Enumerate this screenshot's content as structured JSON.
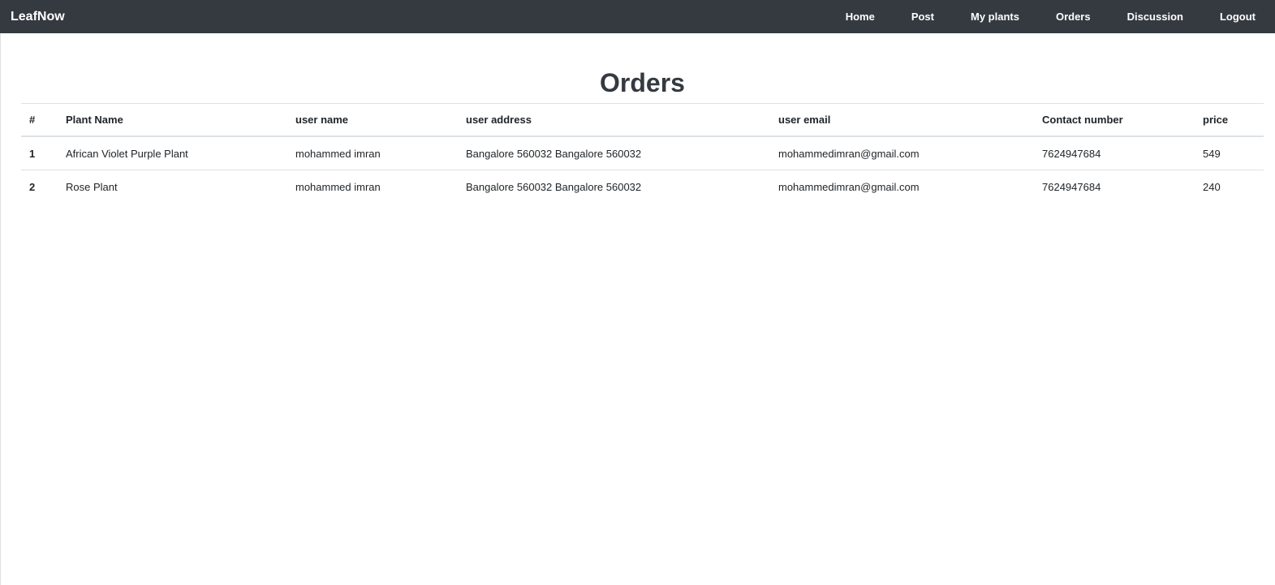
{
  "navbar": {
    "brand": "LeafNow",
    "links": [
      {
        "label": "Home"
      },
      {
        "label": "Post"
      },
      {
        "label": "My plants"
      },
      {
        "label": "Orders"
      },
      {
        "label": "Discussion"
      },
      {
        "label": "Logout"
      }
    ]
  },
  "page": {
    "title": "Orders"
  },
  "table": {
    "columns": [
      "#",
      "Plant Name",
      "user name",
      "user address",
      "user email",
      "Contact number",
      "price"
    ],
    "rows": [
      [
        "1",
        "African Violet Purple Plant",
        "mohammed imran",
        "Bangalore 560032 Bangalore 560032",
        "mohammedimran@gmail.com",
        "7624947684",
        "549"
      ],
      [
        "2",
        "Rose Plant",
        "mohammed imran",
        "Bangalore 560032 Bangalore 560032",
        "mohammedimran@gmail.com",
        "7624947684",
        "240"
      ]
    ]
  },
  "colors": {
    "navbar_bg": "#343a40",
    "navbar_text": "#ffffff",
    "title_text": "#343a40",
    "border": "#dee2e6"
  }
}
